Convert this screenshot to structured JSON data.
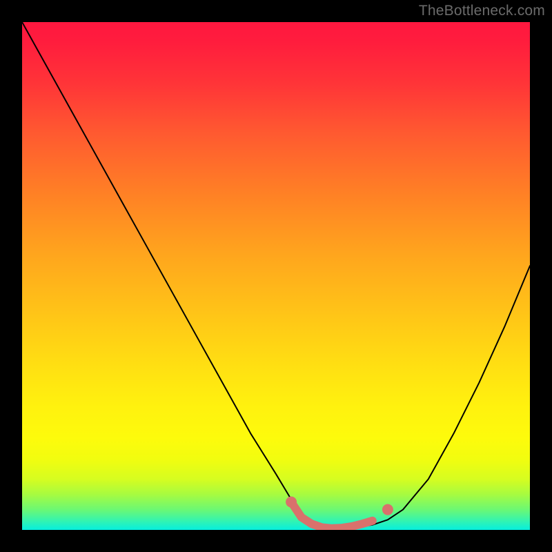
{
  "watermark": "TheBottleneck.com",
  "chart_data": {
    "type": "line",
    "title": "",
    "xlabel": "",
    "ylabel": "",
    "xlim": [
      0,
      100
    ],
    "ylim": [
      0,
      100
    ],
    "grid": false,
    "series": [
      {
        "name": "bottleneck-curve",
        "color": "#000000",
        "stroke_width": 2,
        "x": [
          0,
          5,
          10,
          15,
          20,
          25,
          30,
          35,
          40,
          45,
          50,
          53,
          55,
          58,
          60,
          63,
          66,
          69,
          72,
          75,
          80,
          85,
          90,
          95,
          100
        ],
        "values": [
          100,
          91,
          82,
          73,
          64,
          55,
          46,
          37,
          28,
          19,
          11,
          6,
          3,
          1,
          0,
          0,
          0.5,
          1,
          2,
          4,
          10,
          19,
          29,
          40,
          52
        ]
      },
      {
        "name": "highlight-valley",
        "color": "#d9716c",
        "stroke_width": 12,
        "x": [
          53,
          55,
          57,
          59,
          61,
          63,
          65,
          67,
          69
        ],
        "values": [
          5.5,
          2.5,
          1.2,
          0.5,
          0.3,
          0.4,
          0.7,
          1.2,
          1.8
        ]
      }
    ],
    "points": [
      {
        "name": "highlight-dot-start",
        "x": 53,
        "y": 5.5,
        "r": 8,
        "color": "#d9716c"
      },
      {
        "name": "highlight-dot",
        "x": 72,
        "y": 4.0,
        "r": 8,
        "color": "#d9716c"
      }
    ]
  }
}
